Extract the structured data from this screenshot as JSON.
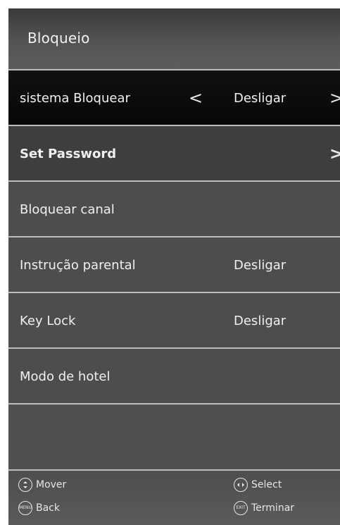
{
  "title": "Bloqueio",
  "rows": [
    {
      "label": "sistema Bloquear",
      "value": "Desligar",
      "left_arrow": "<",
      "right_arrow": ">"
    },
    {
      "label": "Set Password",
      "right_arrow": ">"
    },
    {
      "label": "Bloquear canal"
    },
    {
      "label": "Instrução parental",
      "value": "Desligar"
    },
    {
      "label": "Key Lock",
      "value": "Desligar"
    },
    {
      "label": "Modo de hotel"
    }
  ],
  "footer": {
    "mover": {
      "label": "Mover",
      "icon": "up-down-arrows-icon"
    },
    "select": {
      "label": "Select",
      "icon": "left-right-arrows-icon"
    },
    "back": {
      "label": "Back",
      "icon": "menu-button-icon",
      "icon_text": "MENU"
    },
    "terminar": {
      "label": "Terminar",
      "icon": "exit-button-icon",
      "icon_text": "EXIT"
    }
  },
  "colors": {
    "selected_row": "#0a0a0a",
    "menu_background": "#4d4d4d",
    "separator": "#bdbdbd",
    "text": "#f0f0f0"
  }
}
